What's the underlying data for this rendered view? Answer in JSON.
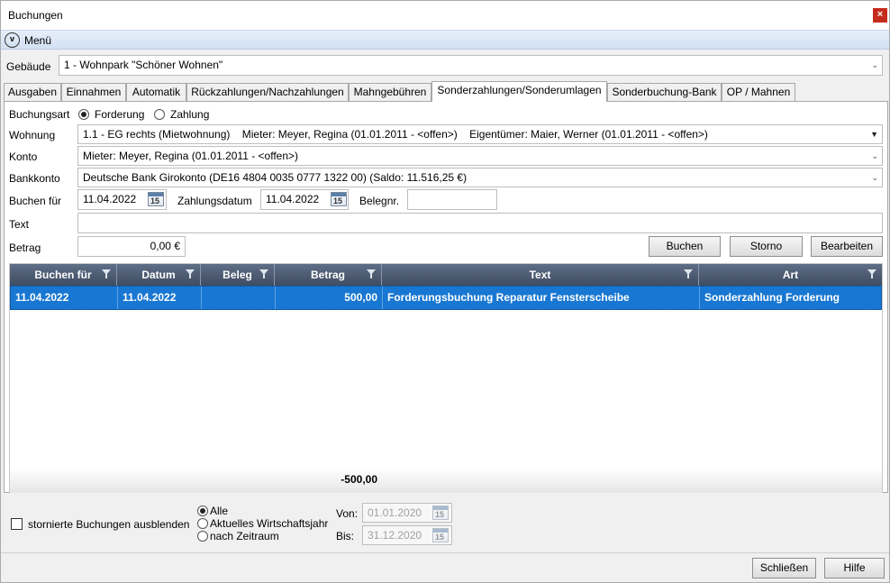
{
  "window": {
    "title": "Buchungen"
  },
  "menu": {
    "label": "Menü"
  },
  "gebaeude": {
    "label": "Gebäude",
    "value": "1 - Wohnpark \"Schöner Wohnen\""
  },
  "tabs": [
    "Ausgaben",
    "Einnahmen",
    "Automatik",
    "Rückzahlungen/Nachzahlungen",
    "Mahngebühren",
    "Sonderzahlungen/Sonderumlagen",
    "Sonderbuchung-Bank",
    "OP / Mahnen"
  ],
  "active_tab": "Sonderzahlungen/Sonderumlagen",
  "form": {
    "buchungsart_label": "Buchungsart",
    "buchungsart_options": [
      "Forderung",
      "Zahlung"
    ],
    "buchungsart_selected": "Forderung",
    "wohnung_label": "Wohnung",
    "wohnung_value": "1.1 - EG rechts (Mietwohnung)    Mieter: Meyer, Regina (01.01.2011 - <offen>)    Eigentümer: Maier, Werner (01.01.2011 - <offen>)",
    "konto_label": "Konto",
    "konto_value": "Mieter: Meyer, Regina (01.01.2011 - <offen>)",
    "bankkonto_label": "Bankkonto",
    "bankkonto_value": "Deutsche Bank Girokonto (DE16 4804 0035 0777 1322 00) (Saldo: 11.516,25 €)",
    "buchen_fuer_label": "Buchen für",
    "buchen_fuer_value": "11.04.2022",
    "zahlungsdatum_label": "Zahlungsdatum",
    "zahlungsdatum_value": "11.04.2022",
    "belegnr_label": "Belegnr.",
    "belegnr_value": "",
    "text_label": "Text",
    "text_value": "",
    "betrag_label": "Betrag",
    "betrag_value": "0,00 €",
    "calendar_icon_text": "15"
  },
  "buttons": {
    "buchen": "Buchen",
    "storno": "Storno",
    "bearbeiten": "Bearbeiten",
    "schliessen": "Schließen",
    "hilfe": "Hilfe"
  },
  "grid": {
    "columns": [
      "Buchen für",
      "Datum",
      "Beleg",
      "Betrag",
      "Text",
      "Art"
    ],
    "rows": [
      {
        "buchen_fuer": "11.04.2022",
        "datum": "11.04.2022",
        "beleg": "",
        "betrag": "500,00",
        "text": "Forderungsbuchung Reparatur Fensterscheibe",
        "art": "Sonderzahlung Forderung"
      }
    ],
    "sum": "-500,00"
  },
  "filter": {
    "hide_canceled_label": "stornierte Buchungen ausblenden",
    "hide_canceled_checked": false,
    "range_options": [
      "Alle",
      "Aktuelles Wirtschaftsjahr",
      "nach Zeitraum"
    ],
    "range_selected": "Alle",
    "von_label": "Von:",
    "von_value": "01.01.2020",
    "bis_label": "Bis:",
    "bis_value": "31.12.2020"
  },
  "colors": {
    "selection": "#1877d2",
    "header": "#4a5870",
    "menubar": "#dce7f6",
    "close": "#c42b1c"
  }
}
